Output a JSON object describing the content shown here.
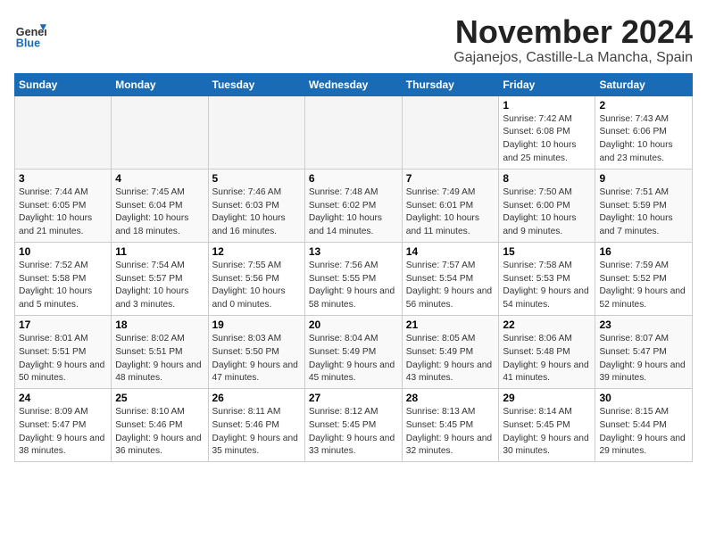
{
  "logo": {
    "text_general": "General",
    "text_blue": "Blue"
  },
  "header": {
    "month": "November 2024",
    "location": "Gajanejos, Castille-La Mancha, Spain"
  },
  "weekdays": [
    "Sunday",
    "Monday",
    "Tuesday",
    "Wednesday",
    "Thursday",
    "Friday",
    "Saturday"
  ],
  "weeks": [
    [
      {
        "day": "",
        "info": ""
      },
      {
        "day": "",
        "info": ""
      },
      {
        "day": "",
        "info": ""
      },
      {
        "day": "",
        "info": ""
      },
      {
        "day": "",
        "info": ""
      },
      {
        "day": "1",
        "info": "Sunrise: 7:42 AM\nSunset: 6:08 PM\nDaylight: 10 hours and 25 minutes."
      },
      {
        "day": "2",
        "info": "Sunrise: 7:43 AM\nSunset: 6:06 PM\nDaylight: 10 hours and 23 minutes."
      }
    ],
    [
      {
        "day": "3",
        "info": "Sunrise: 7:44 AM\nSunset: 6:05 PM\nDaylight: 10 hours and 21 minutes."
      },
      {
        "day": "4",
        "info": "Sunrise: 7:45 AM\nSunset: 6:04 PM\nDaylight: 10 hours and 18 minutes."
      },
      {
        "day": "5",
        "info": "Sunrise: 7:46 AM\nSunset: 6:03 PM\nDaylight: 10 hours and 16 minutes."
      },
      {
        "day": "6",
        "info": "Sunrise: 7:48 AM\nSunset: 6:02 PM\nDaylight: 10 hours and 14 minutes."
      },
      {
        "day": "7",
        "info": "Sunrise: 7:49 AM\nSunset: 6:01 PM\nDaylight: 10 hours and 11 minutes."
      },
      {
        "day": "8",
        "info": "Sunrise: 7:50 AM\nSunset: 6:00 PM\nDaylight: 10 hours and 9 minutes."
      },
      {
        "day": "9",
        "info": "Sunrise: 7:51 AM\nSunset: 5:59 PM\nDaylight: 10 hours and 7 minutes."
      }
    ],
    [
      {
        "day": "10",
        "info": "Sunrise: 7:52 AM\nSunset: 5:58 PM\nDaylight: 10 hours and 5 minutes."
      },
      {
        "day": "11",
        "info": "Sunrise: 7:54 AM\nSunset: 5:57 PM\nDaylight: 10 hours and 3 minutes."
      },
      {
        "day": "12",
        "info": "Sunrise: 7:55 AM\nSunset: 5:56 PM\nDaylight: 10 hours and 0 minutes."
      },
      {
        "day": "13",
        "info": "Sunrise: 7:56 AM\nSunset: 5:55 PM\nDaylight: 9 hours and 58 minutes."
      },
      {
        "day": "14",
        "info": "Sunrise: 7:57 AM\nSunset: 5:54 PM\nDaylight: 9 hours and 56 minutes."
      },
      {
        "day": "15",
        "info": "Sunrise: 7:58 AM\nSunset: 5:53 PM\nDaylight: 9 hours and 54 minutes."
      },
      {
        "day": "16",
        "info": "Sunrise: 7:59 AM\nSunset: 5:52 PM\nDaylight: 9 hours and 52 minutes."
      }
    ],
    [
      {
        "day": "17",
        "info": "Sunrise: 8:01 AM\nSunset: 5:51 PM\nDaylight: 9 hours and 50 minutes."
      },
      {
        "day": "18",
        "info": "Sunrise: 8:02 AM\nSunset: 5:51 PM\nDaylight: 9 hours and 48 minutes."
      },
      {
        "day": "19",
        "info": "Sunrise: 8:03 AM\nSunset: 5:50 PM\nDaylight: 9 hours and 47 minutes."
      },
      {
        "day": "20",
        "info": "Sunrise: 8:04 AM\nSunset: 5:49 PM\nDaylight: 9 hours and 45 minutes."
      },
      {
        "day": "21",
        "info": "Sunrise: 8:05 AM\nSunset: 5:49 PM\nDaylight: 9 hours and 43 minutes."
      },
      {
        "day": "22",
        "info": "Sunrise: 8:06 AM\nSunset: 5:48 PM\nDaylight: 9 hours and 41 minutes."
      },
      {
        "day": "23",
        "info": "Sunrise: 8:07 AM\nSunset: 5:47 PM\nDaylight: 9 hours and 39 minutes."
      }
    ],
    [
      {
        "day": "24",
        "info": "Sunrise: 8:09 AM\nSunset: 5:47 PM\nDaylight: 9 hours and 38 minutes."
      },
      {
        "day": "25",
        "info": "Sunrise: 8:10 AM\nSunset: 5:46 PM\nDaylight: 9 hours and 36 minutes."
      },
      {
        "day": "26",
        "info": "Sunrise: 8:11 AM\nSunset: 5:46 PM\nDaylight: 9 hours and 35 minutes."
      },
      {
        "day": "27",
        "info": "Sunrise: 8:12 AM\nSunset: 5:45 PM\nDaylight: 9 hours and 33 minutes."
      },
      {
        "day": "28",
        "info": "Sunrise: 8:13 AM\nSunset: 5:45 PM\nDaylight: 9 hours and 32 minutes."
      },
      {
        "day": "29",
        "info": "Sunrise: 8:14 AM\nSunset: 5:45 PM\nDaylight: 9 hours and 30 minutes."
      },
      {
        "day": "30",
        "info": "Sunrise: 8:15 AM\nSunset: 5:44 PM\nDaylight: 9 hours and 29 minutes."
      }
    ]
  ]
}
